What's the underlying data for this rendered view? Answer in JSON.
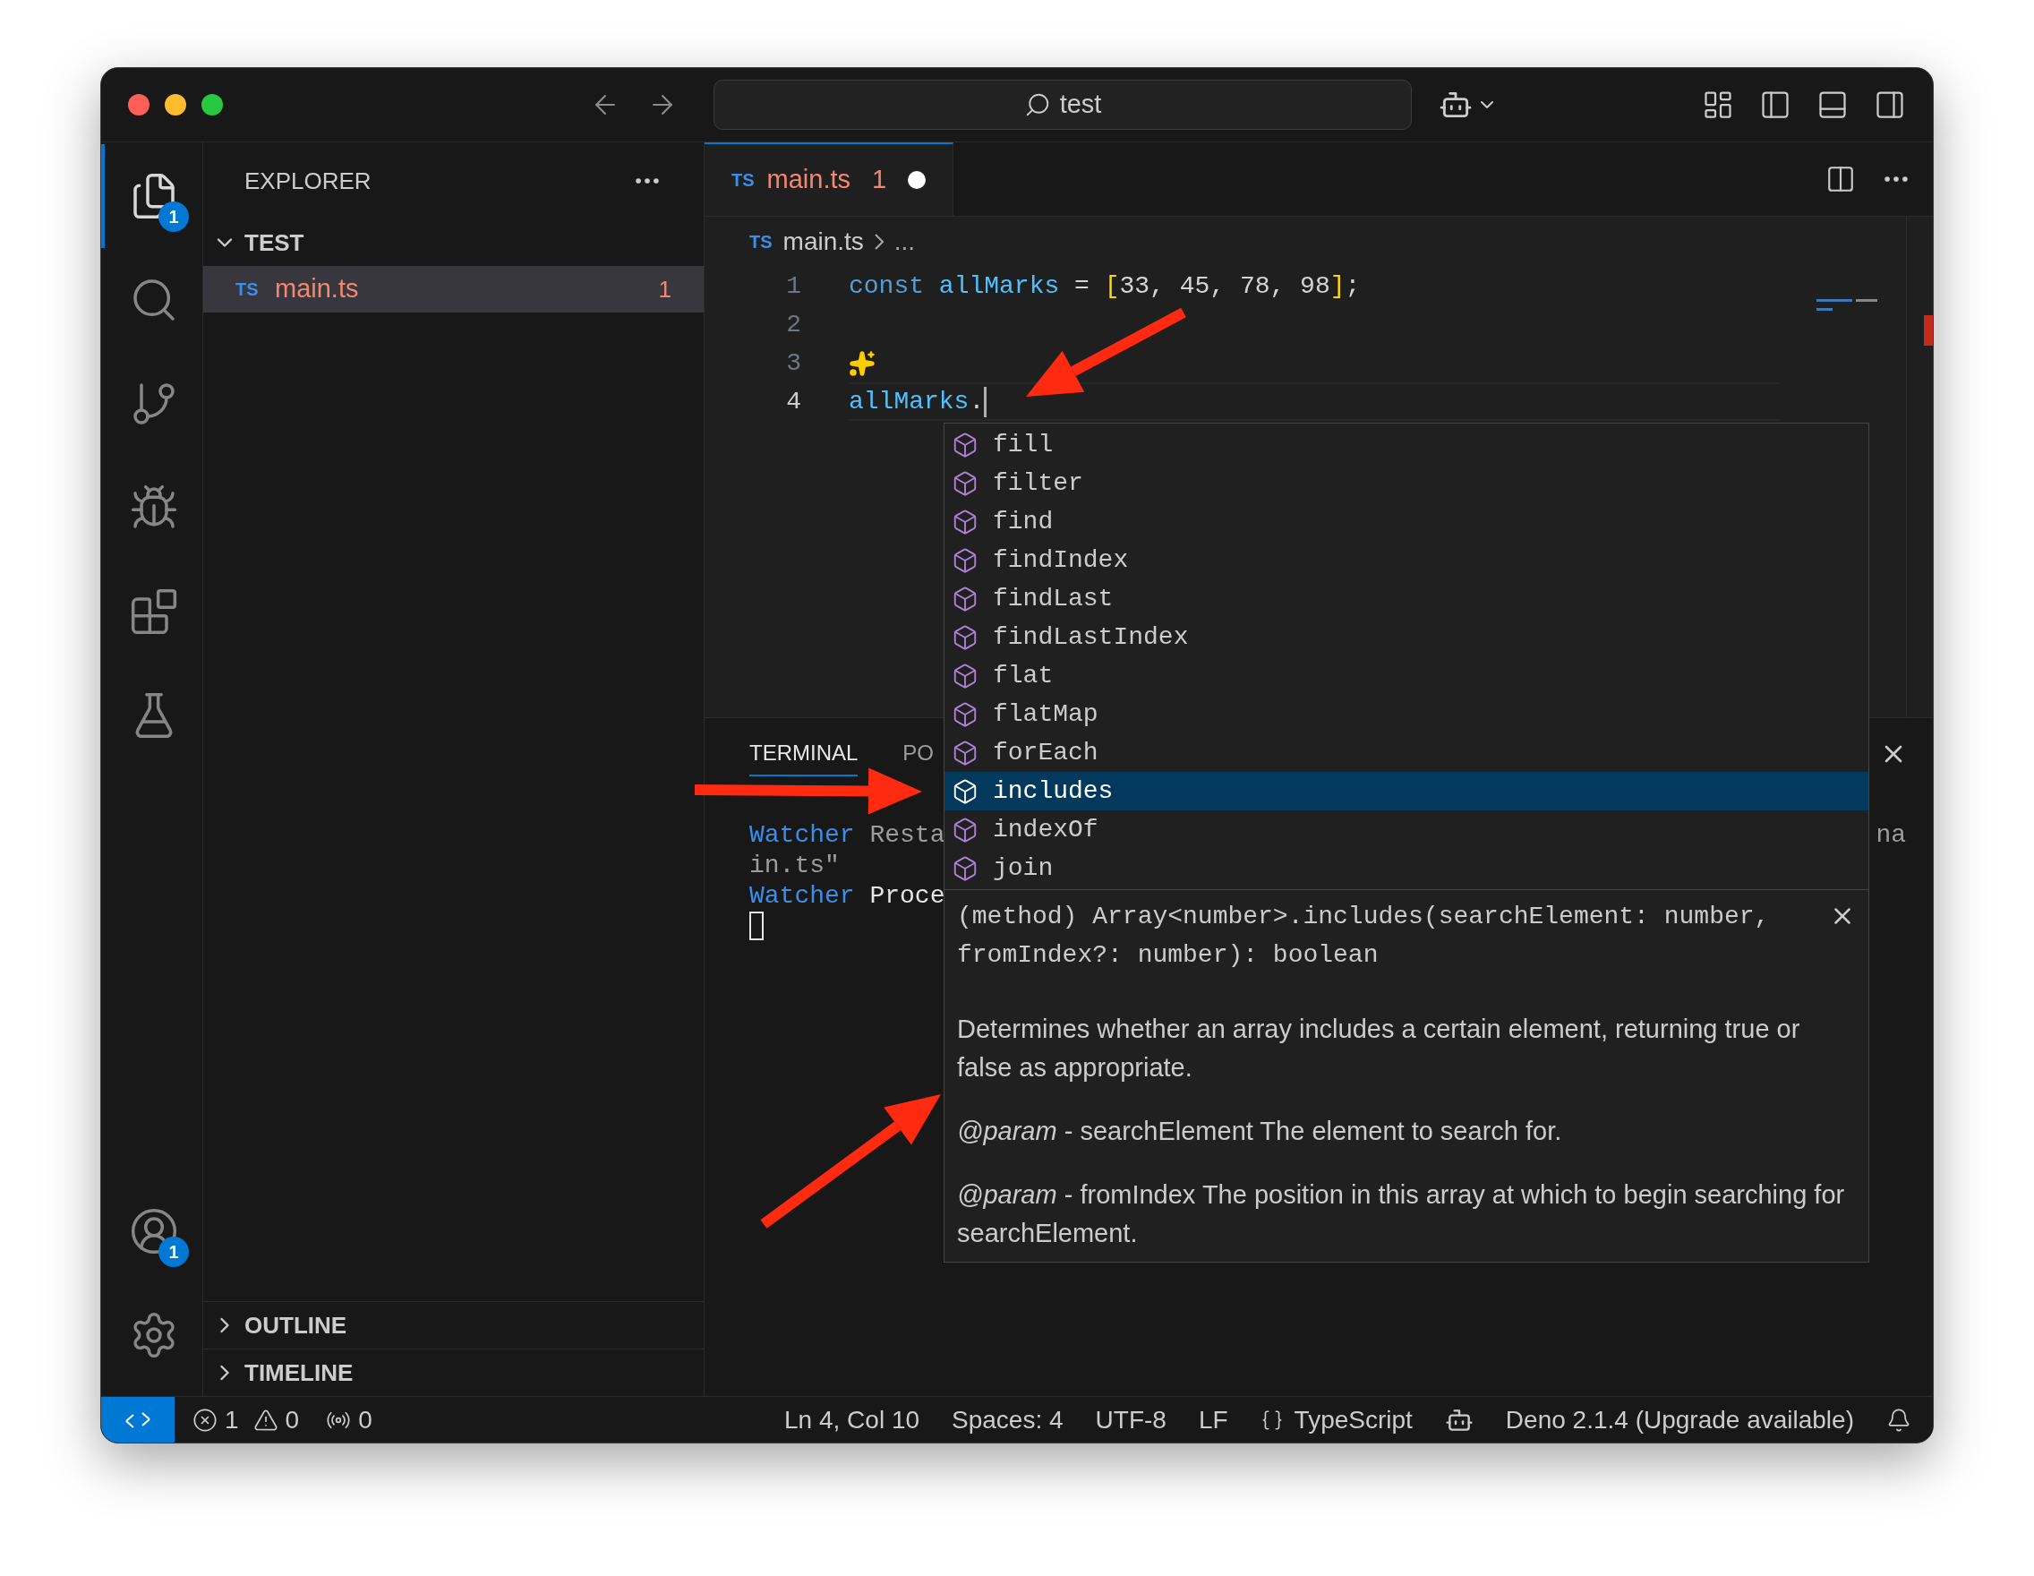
{
  "title_bar": {
    "search": "test"
  },
  "activity_bar": {
    "items": [
      {
        "kind": "explorer",
        "selected": true,
        "badge": "1"
      },
      {
        "kind": "search",
        "selected": false
      },
      {
        "kind": "source-control",
        "selected": false
      },
      {
        "kind": "run-debug",
        "selected": false
      },
      {
        "kind": "extensions",
        "selected": false
      },
      {
        "kind": "testing",
        "selected": false
      }
    ],
    "bottom": [
      {
        "kind": "accounts",
        "badge": "1"
      },
      {
        "kind": "settings"
      }
    ]
  },
  "sidebar": {
    "title": "EXPLORER",
    "sections": [
      {
        "label": "TEST",
        "expanded": true,
        "files": [
          {
            "icon": "TS",
            "name": "main.ts",
            "problems": "1",
            "selected": true
          }
        ]
      },
      {
        "label": "OUTLINE",
        "expanded": false
      },
      {
        "label": "TIMELINE",
        "expanded": false
      }
    ]
  },
  "editor": {
    "tabs": [
      {
        "icon": "TS",
        "label": "main.ts",
        "problems": "1",
        "dirty": true,
        "selected": true
      }
    ],
    "breadcrumb": {
      "icon": "TS",
      "file": "main.ts",
      "more": "..."
    },
    "lines": [
      {
        "number": "1",
        "current": false,
        "tokens": [
          {
            "kind": "keyword",
            "text": "const "
          },
          {
            "kind": "variable",
            "text": "allMarks"
          },
          {
            "kind": "plain",
            "text": " = "
          },
          {
            "kind": "bracket",
            "text": "["
          },
          {
            "kind": "plain",
            "text": "33, 45, 78, 98"
          },
          {
            "kind": "bracket",
            "text": "]"
          },
          {
            "kind": "plain",
            "text": ";"
          }
        ]
      },
      {
        "number": "2",
        "current": false
      },
      {
        "number": "3",
        "current": false,
        "hint": true
      },
      {
        "number": "4",
        "current": true,
        "tokens": [
          {
            "kind": "variable",
            "text": "allMarks"
          },
          {
            "kind": "plain",
            "text": "."
          }
        ]
      }
    ]
  },
  "suggest": {
    "items": [
      {
        "label": "fill",
        "selected": false
      },
      {
        "label": "filter",
        "selected": false
      },
      {
        "label": "find",
        "selected": false
      },
      {
        "label": "findIndex",
        "selected": false
      },
      {
        "label": "findLast",
        "selected": false
      },
      {
        "label": "findLastIndex",
        "selected": false
      },
      {
        "label": "flat",
        "selected": false
      },
      {
        "label": "flatMap",
        "selected": false
      },
      {
        "label": "forEach",
        "selected": false
      },
      {
        "label": "includes",
        "selected": true
      },
      {
        "label": "indexOf",
        "selected": false
      },
      {
        "label": "join",
        "selected": false
      }
    ],
    "details": {
      "signature": "(method) Array<number>.includes(searchElement: number, fromIndex?: number): boolean",
      "paragraphs": [
        "Determines whether an array includes a certain element, returning true or false as appropriate.",
        "*@param* - searchElement The element to search for.",
        "*@param* - fromIndex The position in this array at which to begin searching for searchElement."
      ]
    }
  },
  "panel": {
    "tabs": [
      {
        "label": "TERMINAL",
        "selected": true
      },
      {
        "label": "PO",
        "selected": false
      }
    ],
    "terminal_lines": [
      {
        "segments": [
          {
            "kind": "label",
            "text": "Watcher"
          },
          {
            "kind": "dim",
            "text": " Resta"
          }
        ],
        "end": "na"
      },
      {
        "segments": [
          {
            "kind": "dim",
            "text": "in.ts\""
          }
        ]
      },
      {
        "segments": [
          {
            "kind": "label",
            "text": "Watcher"
          },
          {
            "kind": "plain",
            "text": " Proce"
          }
        ]
      }
    ]
  },
  "status_bar": {
    "errors": "1",
    "warnings": "0",
    "ports": "0",
    "items": [
      "Ln 4, Col 10",
      "Spaces: 4",
      "UTF-8",
      "LF"
    ],
    "language": "TypeScript",
    "runtime": "Deno 2.1.4 (Upgrade available)"
  }
}
